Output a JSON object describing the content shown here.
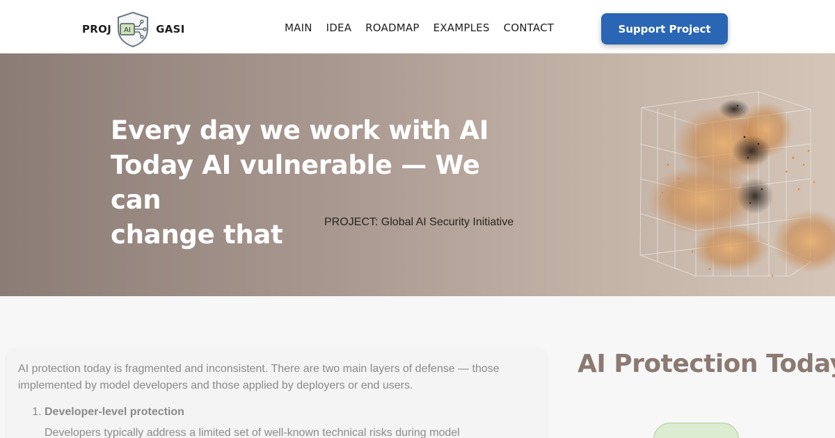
{
  "header": {
    "logo_left": "PROJ",
    "logo_badge": "AI",
    "logo_right": "GASI",
    "nav": [
      "MAIN",
      "IDEA",
      "ROADMAP",
      "EXAMPLES",
      "CONTACT"
    ],
    "cta_label": "Support Project"
  },
  "hero": {
    "title_lines": [
      "Every day we work with AI",
      "Today AI vulnerable — We can",
      "change that"
    ],
    "subtitle": "PROJECT: Global AI Security Initiative"
  },
  "protection": {
    "heading": "AI Protection Today",
    "intro": "AI protection today is fragmented and inconsistent. There are two main layers of defense — those implemented by model developers and those applied by deployers or end users.",
    "items": [
      {
        "title": "Developer-level protection",
        "desc": "Developers typically address a limited set of well-known technical risks during model"
      }
    ]
  },
  "colors": {
    "brand_blue": "#2a66b3",
    "heading_brown": "#8b7a72"
  }
}
